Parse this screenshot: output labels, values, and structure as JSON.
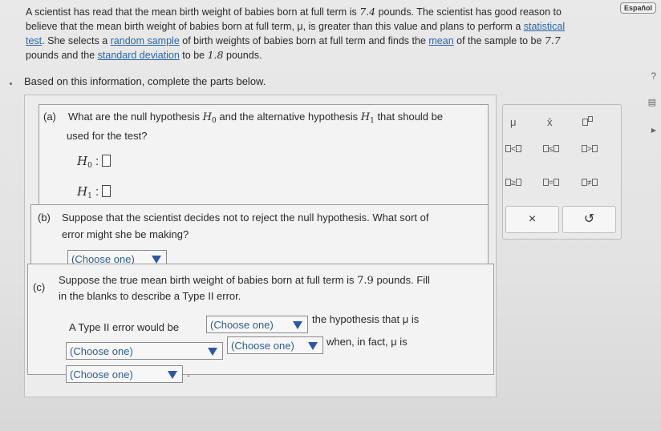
{
  "lang": "Español",
  "intro": {
    "l1": "A scientist has read that the mean birth weight of babies born at full term is ",
    "v1": "7.4",
    "l1b": " pounds. The scientist has good reason to",
    "l2a": "believe that the mean birth weight of babies born at full term, μ, is greater than this value and plans to perform a ",
    "l2link": "statistical",
    "l3link": "test",
    "l3a": ". She selects a ",
    "l3link2": "random sample",
    "l3b": " of birth weights of babies born at full term and finds the ",
    "l3link3": "mean",
    "l3c": " of the sample to be ",
    "v2": "7.7",
    "l4a": "pounds and the ",
    "l4link": "standard deviation",
    "l4b": " to be ",
    "v3": "1.8",
    "l4c": " pounds."
  },
  "based": "Based on this information, complete the parts below.",
  "a": {
    "label": "(a)",
    "q1": "What are the null hypothesis",
    "q2": "and the alternative hypothesis",
    "q3": "that should be",
    "q4": "used for the test?",
    "h0": "H",
    "h0sub": "0",
    "h1": "H",
    "h1sub": "1"
  },
  "b": {
    "label": "(b)",
    "q1": "Suppose that the scientist decides not to reject the null hypothesis. What sort of",
    "q2": "error might she be making?",
    "choose": "(Choose one)"
  },
  "c": {
    "label": "(c)",
    "q1": "Suppose the true mean birth weight of babies born at full term is ",
    "v": "7.9",
    "q1b": " pounds. Fill",
    "q2": "in the blanks to describe a Type II error.",
    "s1": "A Type II error would be",
    "s2": "the hypothesis that μ is",
    "s3": "when, in fact, μ is",
    "choose": "(Choose one)"
  },
  "palette": {
    "mu": "μ",
    "xbar": "x̄",
    "lt": "<",
    "le": "≤",
    "gt": ">",
    "ge": "≥",
    "eq": "=",
    "ne": "≠",
    "x": "×",
    "undo": "↺"
  },
  "side": {
    "help": "?",
    "calc": "▤",
    "play": "▶"
  }
}
